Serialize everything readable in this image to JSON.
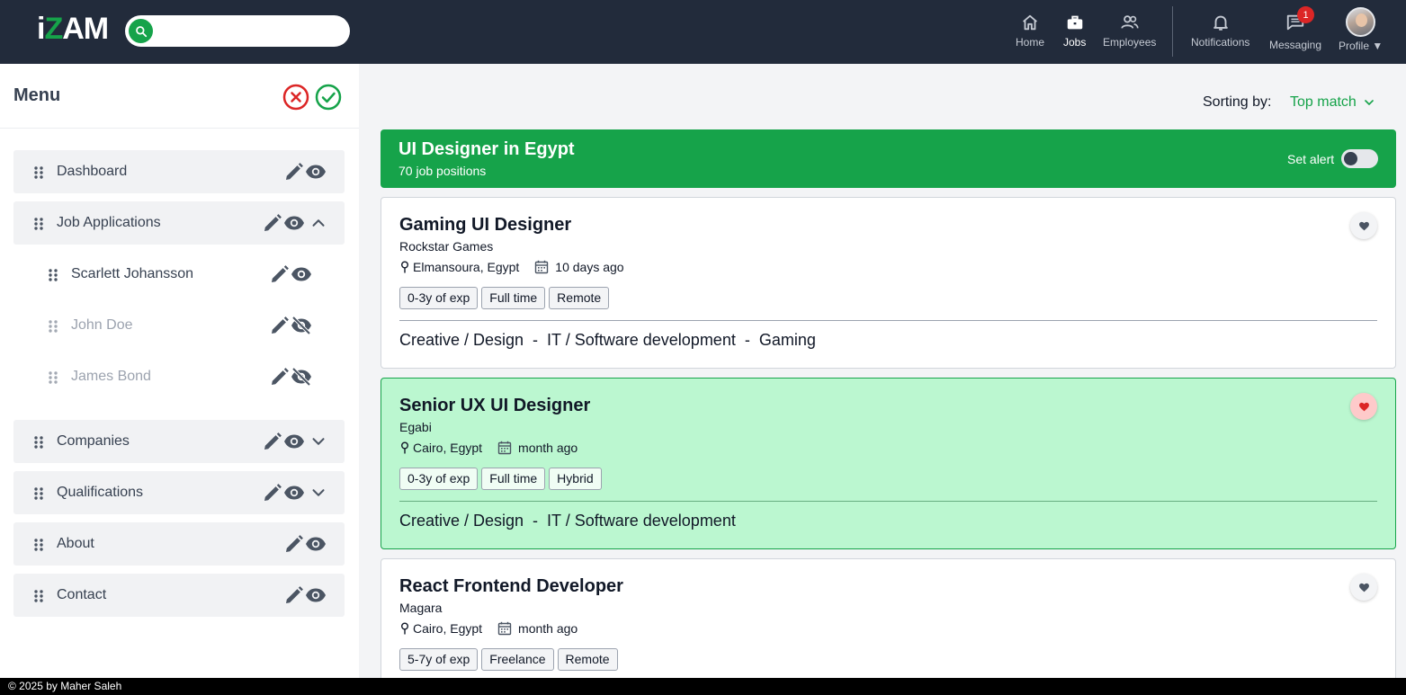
{
  "header": {
    "logo_prefix": "i",
    "logo_z": "Z",
    "logo_suffix": "AM",
    "search": {
      "value": "",
      "placeholder": ""
    },
    "nav": [
      {
        "label": "Home",
        "icon": "home-icon"
      },
      {
        "label": "Jobs",
        "icon": "briefcase-icon",
        "active": true
      },
      {
        "label": "Employees",
        "icon": "people-icon"
      },
      {
        "label": "Notifications",
        "icon": "bell-icon"
      },
      {
        "label": "Messaging",
        "icon": "message-icon",
        "badge": "1"
      },
      {
        "label": "Profile ▼",
        "icon": "avatar"
      }
    ]
  },
  "sidebar": {
    "title": "Menu",
    "items": [
      {
        "label": "Dashboard",
        "visible": true
      },
      {
        "label": "Job Applications",
        "visible": true,
        "expanded": true,
        "children": [
          {
            "label": "Scarlett Johansson",
            "visible": true
          },
          {
            "label": "John Doe",
            "visible": false
          },
          {
            "label": "James Bond",
            "visible": false
          }
        ]
      },
      {
        "label": "Companies",
        "visible": true,
        "expanded": false
      },
      {
        "label": "Qualifications",
        "visible": true,
        "expanded": false
      },
      {
        "label": "About",
        "visible": true
      },
      {
        "label": "Contact",
        "visible": true
      }
    ]
  },
  "main": {
    "sort_label": "Sorting by:",
    "sort_value": "Top match",
    "banner": {
      "title": "UI Designer in Egypt",
      "subtitle": "70 job positions",
      "alert_label": "Set alert",
      "alert_on": false
    },
    "jobs": [
      {
        "title": "Gaming UI Designer",
        "company": "Rockstar Games",
        "location": "Elmansoura, Egypt",
        "posted": "10 days ago",
        "tags": [
          "0-3y of exp",
          "Full time",
          "Remote"
        ],
        "categories": "Creative / Design  -  IT / Software development  -  Gaming",
        "favorite": false
      },
      {
        "title": "Senior UX UI Designer",
        "company": "Egabi",
        "location": "Cairo, Egypt",
        "posted": "month ago",
        "tags": [
          "0-3y of exp",
          "Full time",
          "Hybrid"
        ],
        "categories": "Creative / Design  -  IT / Software development",
        "favorite": true
      },
      {
        "title": "React Frontend Developer",
        "company": "Magara",
        "location": "Cairo, Egypt",
        "posted": "month ago",
        "tags": [
          "5-7y of exp",
          "Freelance",
          "Remote"
        ],
        "categories": "",
        "favorite": false
      }
    ]
  },
  "footer": {
    "text": "© 2025 by Maher Saleh"
  },
  "colors": {
    "brand_green": "#16a34a",
    "topbar": "#222b3b",
    "highlight_card": "#bbf7d0",
    "danger": "#dc2626"
  }
}
